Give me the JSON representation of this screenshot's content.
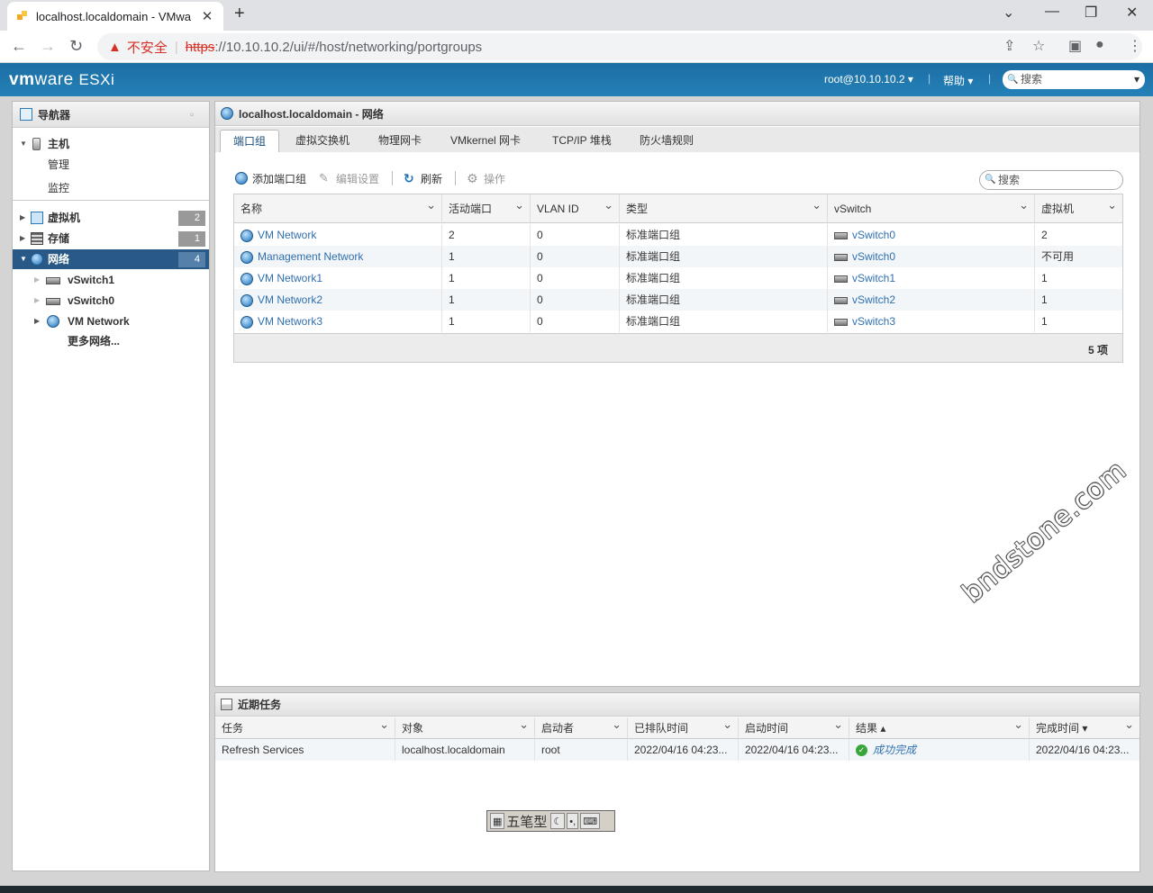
{
  "browser": {
    "tab_title": "localhost.localdomain - VMwa",
    "security_label": "不安全",
    "url_scheme": "https",
    "url_rest": "://10.10.10.2/ui/#/host/networking/portgroups"
  },
  "header": {
    "logo_vm": "vm",
    "logo_ware": "ware",
    "logo_esxi": "ESXi",
    "user": "root@10.10.10.2 ▾",
    "help": "帮助 ▾",
    "search_placeholder": "搜索"
  },
  "navigator": {
    "title": "导航器",
    "host_label": "主机",
    "host_children": [
      "管理",
      "监控"
    ],
    "vms": {
      "label": "虚拟机",
      "count": "2"
    },
    "storage": {
      "label": "存储",
      "count": "1"
    },
    "network": {
      "label": "网络",
      "count": "4"
    },
    "network_children": [
      "vSwitch1",
      "vSwitch0",
      "VM Network"
    ],
    "more_networks": "更多网络..."
  },
  "main": {
    "title": "localhost.localdomain - 网络",
    "tabs": [
      "端口组",
      "虚拟交换机",
      "物理网卡",
      "VMkernel 网卡",
      "TCP/IP 堆栈",
      "防火墙规则"
    ],
    "toolbar": {
      "add": "添加端口组",
      "edit": "编辑设置",
      "refresh": "刷新",
      "actions": "操作"
    },
    "search_placeholder": "搜索",
    "columns": [
      "名称",
      "活动端口",
      "VLAN ID",
      "类型",
      "vSwitch",
      "虚拟机"
    ],
    "rows": [
      {
        "name": "VM Network",
        "active": "2",
        "vlan": "0",
        "type": "标准端口组",
        "vswitch": "vSwitch0",
        "vms": "2"
      },
      {
        "name": "Management Network",
        "active": "1",
        "vlan": "0",
        "type": "标准端口组",
        "vswitch": "vSwitch0",
        "vms": "不可用"
      },
      {
        "name": "VM Network1",
        "active": "1",
        "vlan": "0",
        "type": "标准端口组",
        "vswitch": "vSwitch1",
        "vms": "1"
      },
      {
        "name": "VM Network2",
        "active": "1",
        "vlan": "0",
        "type": "标准端口组",
        "vswitch": "vSwitch2",
        "vms": "1"
      },
      {
        "name": "VM Network3",
        "active": "1",
        "vlan": "0",
        "type": "标准端口组",
        "vswitch": "vSwitch3",
        "vms": "1"
      }
    ],
    "footer_count": "5 项"
  },
  "tasks": {
    "title": "近期任务",
    "columns": [
      "任务",
      "对象",
      "启动者",
      "已排队时间",
      "启动时间",
      "结果 ▴",
      "完成时间 ▾"
    ],
    "rows": [
      {
        "task": "Refresh Services",
        "object": "localhost.localdomain",
        "initiator": "root",
        "queued": "2022/04/16 04:23...",
        "started": "2022/04/16 04:23...",
        "result": "成功完成",
        "completed": "2022/04/16 04:23..."
      }
    ]
  },
  "ime": {
    "mode": "五笔型"
  },
  "watermark": "bndstone.com"
}
